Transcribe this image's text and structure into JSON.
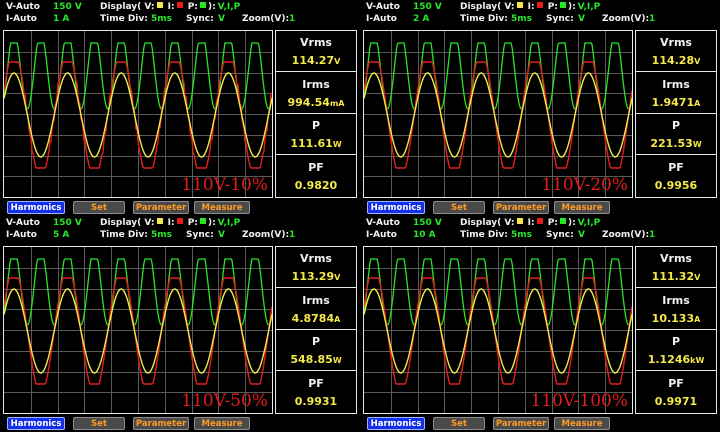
{
  "colors": {
    "voltage": "#f5e84a",
    "current": "#e41d1d",
    "power": "#27e627",
    "grid": "#5a5a5a"
  },
  "panels": [
    {
      "v_mode": "V-Auto",
      "v_range": "150 V",
      "i_mode": "I-Auto",
      "i_range": "1 A",
      "display_label": "Display( V:",
      "display_i": " I:",
      "display_p": " P:",
      "display_close": "):",
      "display_value": "V,I,P",
      "timediv_label": "Time  Div:",
      "timediv_value": "5ms",
      "sync_label": "Sync:",
      "sync_value": "V",
      "zoom_label": "Zoom(V):",
      "zoom_value": "1",
      "caption": "110V-10%",
      "vrms_label": "Vrms",
      "vrms_value": "114.27",
      "vrms_unit": "V",
      "irms_label": "Irms",
      "irms_value": "994.54",
      "irms_unit": "mA",
      "p_label": "P",
      "p_value": "111.61",
      "p_unit": "W",
      "pf_label": "PF",
      "pf_value": "0.9820",
      "buttons": [
        "Harmonics",
        "Set",
        "Parameter",
        "Measure"
      ]
    },
    {
      "v_mode": "V-Auto",
      "v_range": "150 V",
      "i_mode": "I-Auto",
      "i_range": "2 A",
      "display_label": "Display( V:",
      "display_i": " I:",
      "display_p": " P:",
      "display_close": "):",
      "display_value": "V,I,P",
      "timediv_label": "Time  Div:",
      "timediv_value": "5ms",
      "sync_label": "Sync:",
      "sync_value": "V",
      "zoom_label": "Zoom(V):",
      "zoom_value": "1",
      "caption": "110V-20%",
      "vrms_label": "Vrms",
      "vrms_value": "114.28",
      "vrms_unit": "V",
      "irms_label": "Irms",
      "irms_value": "1.9471",
      "irms_unit": "A",
      "p_label": "P",
      "p_value": "221.53",
      "p_unit": "W",
      "pf_label": "PF",
      "pf_value": "0.9956",
      "buttons": [
        "Harmonics",
        "Set",
        "Parameter",
        "Measure"
      ]
    },
    {
      "v_mode": "V-Auto",
      "v_range": "150 V",
      "i_mode": "I-Auto",
      "i_range": "5 A",
      "display_label": "Display( V:",
      "display_i": " I:",
      "display_p": " P:",
      "display_close": "):",
      "display_value": "V,I,P",
      "timediv_label": "Time  Div:",
      "timediv_value": "5ms",
      "sync_label": "Sync:",
      "sync_value": "V",
      "zoom_label": "Zoom(V):",
      "zoom_value": "1",
      "caption": "110V-50%",
      "vrms_label": "Vrms",
      "vrms_value": "113.29",
      "vrms_unit": "V",
      "irms_label": "Irms",
      "irms_value": "4.8784",
      "irms_unit": "A",
      "p_label": "P",
      "p_value": "548.85",
      "p_unit": "W",
      "pf_label": "PF",
      "pf_value": "0.9931",
      "buttons": [
        "Harmonics",
        "Set",
        "Parameter",
        "Measure"
      ]
    },
    {
      "v_mode": "V-Auto",
      "v_range": "150 V",
      "i_mode": "I-Auto",
      "i_range": "10 A",
      "display_label": "Display( V:",
      "display_i": " I:",
      "display_p": " P:",
      "display_close": "):",
      "display_value": "V,I,P",
      "timediv_label": "Time  Div:",
      "timediv_value": "5ms",
      "sync_label": "Sync:",
      "sync_value": "V",
      "zoom_label": "Zoom(V):",
      "zoom_value": "1",
      "caption": "110V-100%",
      "vrms_label": "Vrms",
      "vrms_value": "111.32",
      "vrms_unit": "V",
      "irms_label": "Irms",
      "irms_value": "10.133",
      "irms_unit": "A",
      "p_label": "P",
      "p_value": "1.1246",
      "p_unit": "kW",
      "pf_label": "PF",
      "pf_value": "0.9971",
      "buttons": [
        "Harmonics",
        "Set",
        "Parameter",
        "Measure"
      ]
    }
  ]
}
